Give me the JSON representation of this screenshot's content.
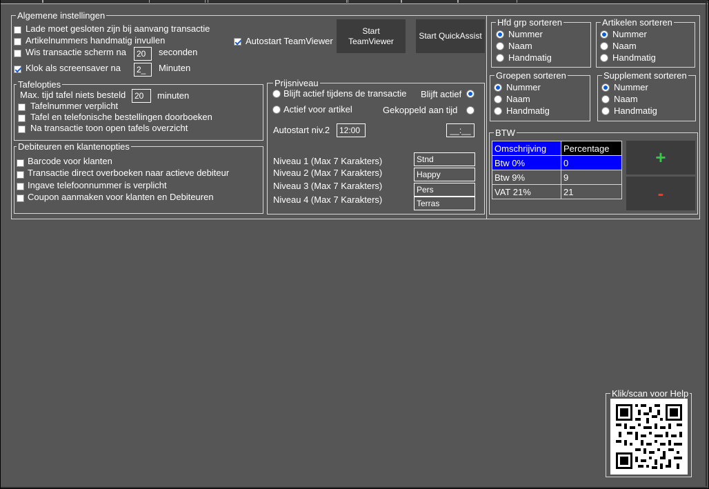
{
  "general": {
    "title": "Algemene instellingen",
    "lade": "Lade moet gesloten zijn bij aanvang transactie",
    "artikelnummers": "Artikelnummers handmatig invullen",
    "wis_prefix": "Wis transactie scherm na",
    "wis_value": "20",
    "wis_suffix": "seconden",
    "klok_prefix": "Klok als screensaver na",
    "klok_value": "2_",
    "klok_suffix": "Minuten",
    "autostart_teamviewer": "Autostart TeamViewer",
    "start_teamviewer": "Start TeamViewer",
    "start_quickassist": "Start QuickAssist"
  },
  "tafel": {
    "title": "Tafelopties",
    "max_prefix": "Max. tijd tafel niets besteld",
    "max_value": "20",
    "max_suffix": "minuten",
    "verplicht": "Tafelnummer verplicht",
    "tafel_tel": "Tafel en telefonische bestellingen doorboeken",
    "na_trans": "Na transactie toon open tafels overzicht"
  },
  "debiteuren": {
    "title": "Debiteuren en klantenopties",
    "barcode": "Barcode voor klanten",
    "transactie": "Transactie direct  overboeken naar actieve debiteur",
    "telefoon": "Ingave telefoonnummer is verplicht",
    "coupon": "Coupon aanmaken voor klanten en Debiteuren"
  },
  "prijs": {
    "title": "Prijsniveau",
    "blijft_tijdens": "Blijft actief tijdens de transactie",
    "blijft_actief": "Blijft actief",
    "actief_artikel": "Actief voor artikel",
    "gekoppeld": "Gekoppeld aan tijd",
    "autostart_label": "Autostart niv.2",
    "autostart_time": "12:00",
    "time_blank": "__:__",
    "niveau1": "Niveau 1 (Max 7 Karakters)",
    "niveau2": "Niveau 2 (Max 7 Karakters)",
    "niveau3": "Niveau 3 (Max 7 Karakters)",
    "niveau4": "Niveau 4 (Max 7 Karakters)",
    "n1_value": "Stnd",
    "n2_value": "Happy",
    "n3_value": "Pers",
    "n4_value": "Terras"
  },
  "sort": {
    "opt_nummer": "Nummer",
    "opt_naam": "Naam",
    "opt_handmatig": "Handmatig",
    "hfd": "Hfd grp sorteren",
    "artikelen": "Artikelen sorteren",
    "groepen": "Groepen sorteren",
    "supplement": "Supplement sorteren"
  },
  "btw": {
    "title": "BTW",
    "h_omschrijving": "Omschrijving",
    "h_percentage": "Percentage",
    "rows": [
      {
        "omschrijving": "Btw  0%",
        "percentage": "0"
      },
      {
        "omschrijving": "Btw  9%",
        "percentage": "9"
      },
      {
        "omschrijving": "VAT 21%",
        "percentage": "21"
      }
    ],
    "add_symbol": "+",
    "remove_symbol": "-",
    "add_color": "#2ecc40",
    "remove_color": "#ff3030"
  },
  "help": {
    "title": "Klik/scan voor Help"
  },
  "colors": {
    "background": "#565656",
    "selected_row": "#0000ff",
    "radio_accent": "#0b5ed7"
  }
}
